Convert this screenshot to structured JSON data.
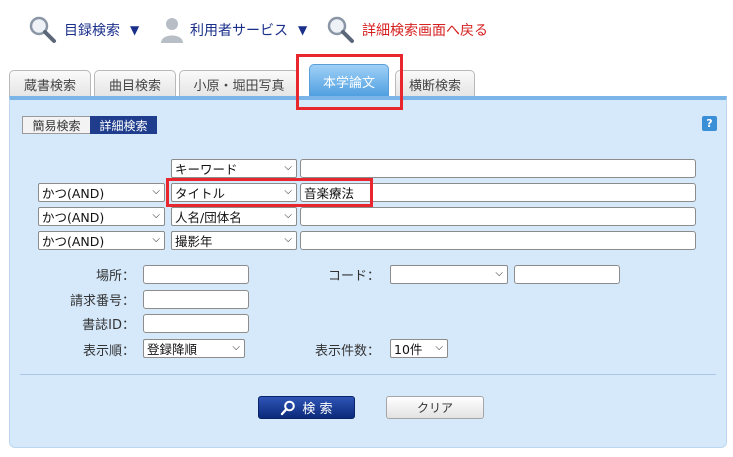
{
  "nav": {
    "catalog_search": "目録検索",
    "user_services": "利用者サービス",
    "back_to_detailed": "詳細検索画面へ戻る",
    "dropdown_glyph": "▼"
  },
  "tabs": [
    {
      "label": "蔵書検索"
    },
    {
      "label": "曲目検索"
    },
    {
      "label": "小原・堀田写真"
    },
    {
      "label": "本学論文"
    },
    {
      "label": "横断検索"
    }
  ],
  "mode": {
    "simple": "簡易検索",
    "detailed": "詳細検索"
  },
  "help_label": "?",
  "rows": [
    {
      "op": "",
      "field": "キーワード",
      "value": ""
    },
    {
      "op": "かつ(AND)",
      "field": "タイトル",
      "value": "音楽療法"
    },
    {
      "op": "かつ(AND)",
      "field": "人名/団体名",
      "value": ""
    },
    {
      "op": "かつ(AND)",
      "field": "撮影年",
      "value": ""
    }
  ],
  "filters": {
    "location_label": "場所：",
    "call_number_label": "請求番号：",
    "bib_id_label": "書誌ID：",
    "display_order_label": "表示順：",
    "display_order_value": "登録降順",
    "code_label": "コード：",
    "code_value": "",
    "per_page_label": "表示件数：",
    "per_page_value": "10件"
  },
  "buttons": {
    "search": "検 索",
    "clear": "クリア"
  },
  "colors": {
    "accent_red": "#e8262e",
    "panel_bg": "#d6e9fb",
    "active_tab": "#4e9ee0",
    "search_button": "#1f3d8c"
  }
}
